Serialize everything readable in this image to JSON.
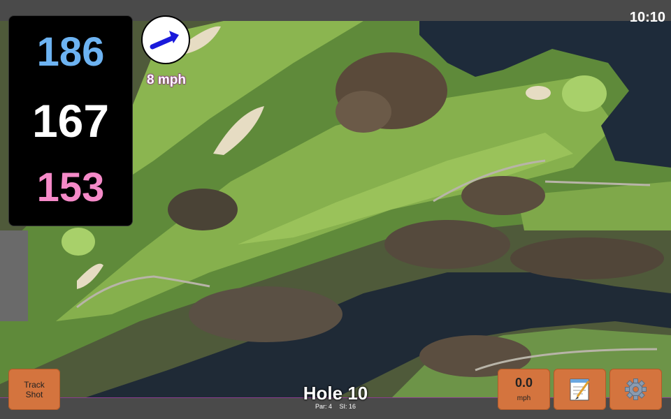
{
  "clock": "10:10",
  "yardages": {
    "back": "186",
    "center": "167",
    "front": "153"
  },
  "wind": {
    "speed_label": "8 mph",
    "direction_icon": "wind-arrow-icon",
    "arrow_color": "#1a1adb"
  },
  "buttons": {
    "track_shot": "Track\nShot",
    "track_line1": "Track",
    "track_line2": "Shot",
    "speed_value": "0.0",
    "speed_unit": "mph",
    "notes_icon": "notepad-icon",
    "settings_icon": "gear-icon"
  },
  "hole": {
    "title": "Hole 10",
    "par_label": "Par: 4",
    "si_label": "SI: 16"
  },
  "colors": {
    "back_yardage": "#6db3f2",
    "center_yardage": "#ffffff",
    "front_yardage": "#f58ac8",
    "button_bg": "#d4743e",
    "bar_border": "#8a3c8f"
  }
}
